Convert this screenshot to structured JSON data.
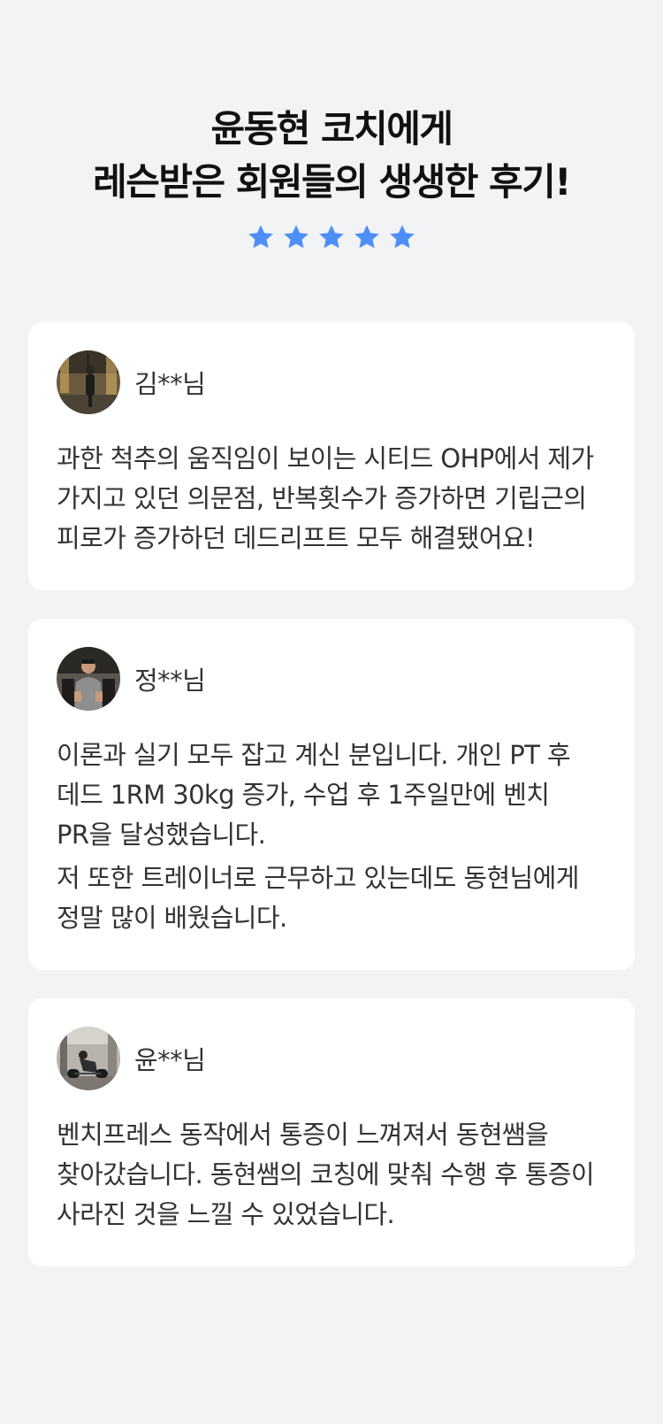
{
  "hero": {
    "title_line1": "윤동현 코치에게",
    "title_line2": "레슨받은 회원들의 생생한 후기!",
    "rating": 5,
    "star_color": "#4d8ef7"
  },
  "reviews": [
    {
      "name": "김**님",
      "avatar_icon": "gym-photo-avatar",
      "paragraphs": [
        "과한 척추의 움직임이 보이는 시티드 OHP에서 제가 가지고 있던 의문점, 반복횟수가 증가하면 기립근의 피로가 증가하던 데드리프트 모두 해결됐어요!"
      ]
    },
    {
      "name": "정**님",
      "avatar_icon": "gym-photo-avatar",
      "paragraphs": [
        "이론과 실기 모두 잡고 계신 분입니다. 개인 PT 후 데드 1RM 30kg 증가, 수업 후 1주일만에 벤치 PR을 달성했습니다.",
        "저 또한 트레이너로 근무하고 있는데도 동현님에게 정말 많이 배웠습니다."
      ]
    },
    {
      "name": "윤**님",
      "avatar_icon": "gym-photo-avatar",
      "paragraphs": [
        "벤치프레스 동작에서 통증이 느껴져서 동현쌤을 찾아갔습니다. 동현쌤의 코칭에 맞춰 수행 후 통증이 사라진 것을 느낄 수 있었습니다."
      ]
    }
  ]
}
